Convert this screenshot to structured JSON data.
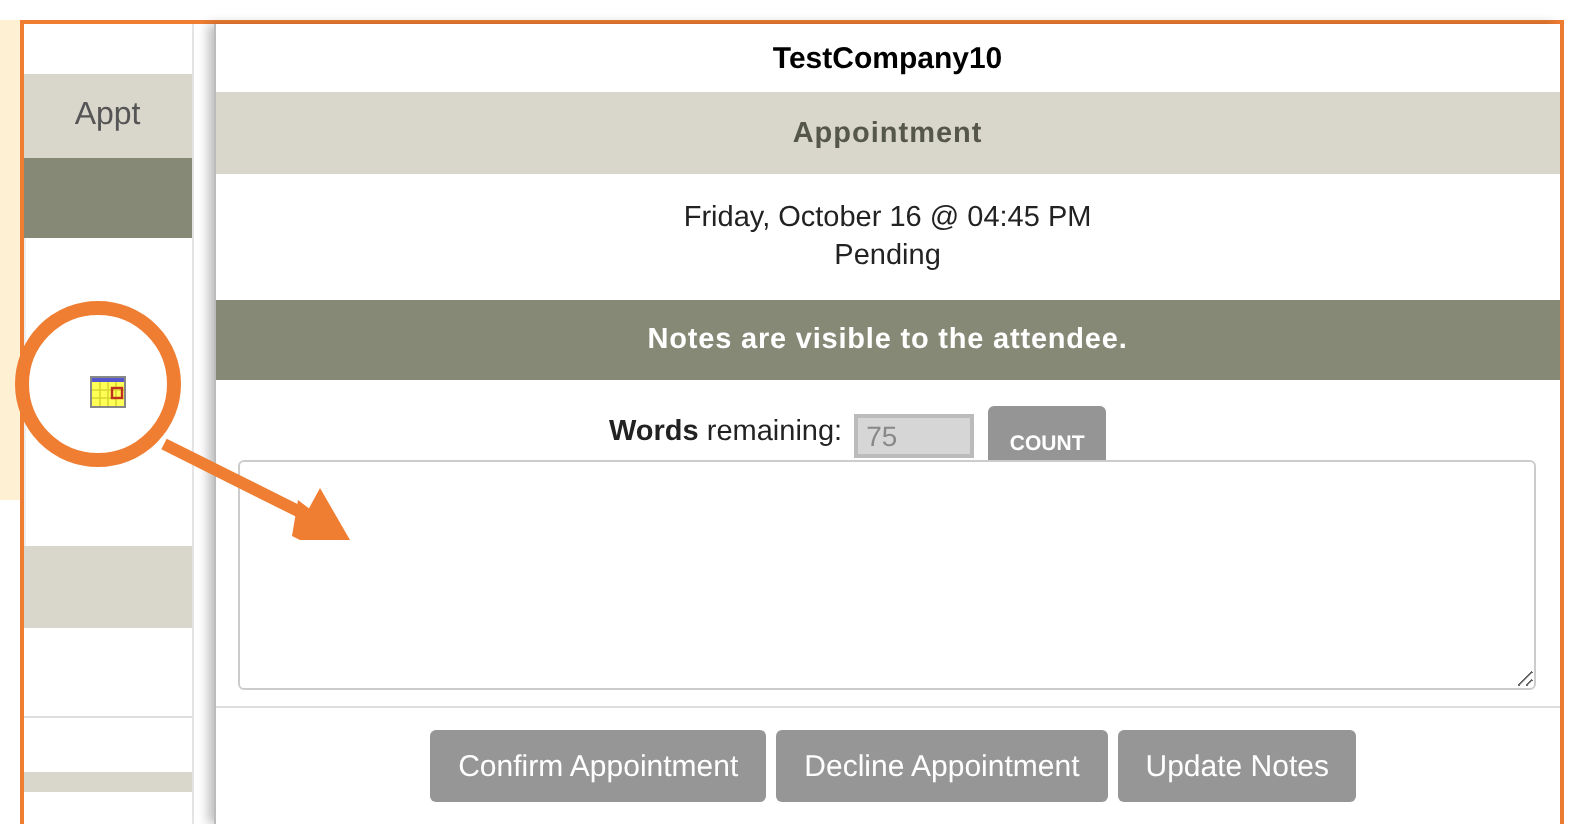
{
  "background_table": {
    "header": "Appt"
  },
  "modal": {
    "title": "TestCompany10",
    "section": "Appointment",
    "datetime": "Friday, October 16 @ 04:45 PM",
    "status": "Pending",
    "notice": "Notes are visible to the attendee.",
    "words_remaining": {
      "label": "**Words** remaining:",
      "value": "75",
      "disabled": true
    },
    "count_button": "COUNT",
    "buttons": [
      "Confirm Appointment",
      "Decline Appointment",
      "Update Notes"
    ]
  }
}
